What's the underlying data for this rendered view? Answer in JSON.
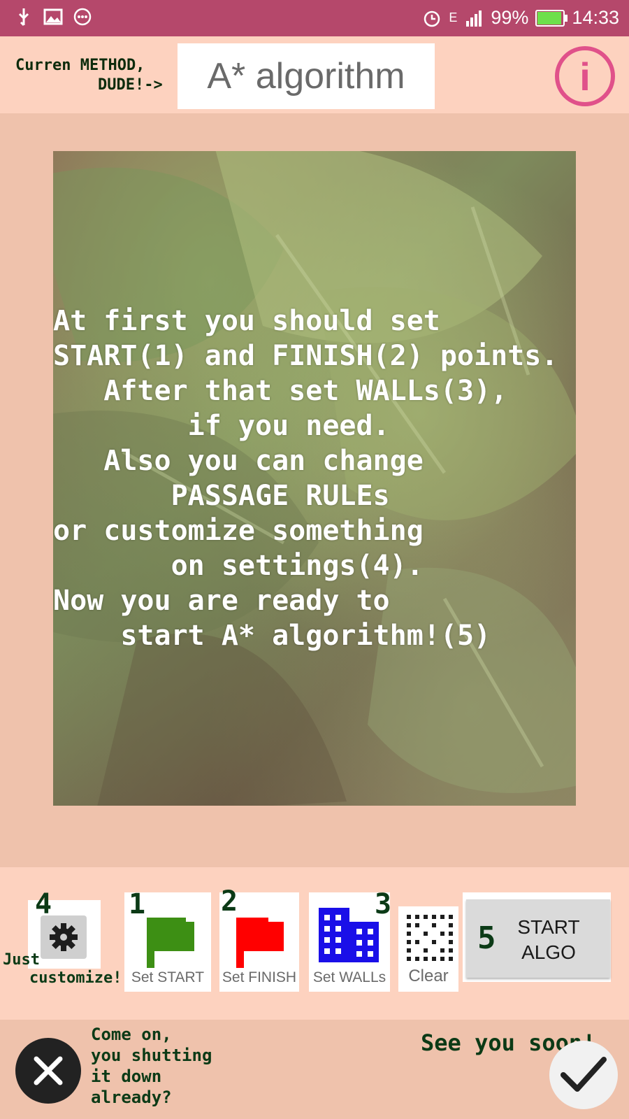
{
  "status_bar": {
    "icons_left": [
      "usb-icon",
      "image-icon",
      "more-icon"
    ],
    "network": "E",
    "battery": "99%",
    "battery_level": 0.99,
    "time": "14:33",
    "colors": {
      "bar": "#b5486b",
      "battery_fill": "#6ee04b"
    }
  },
  "header": {
    "method_label_line1": "Curren METHOD,",
    "method_label_line2": "DUDE!->",
    "current_method": "A* algorithm",
    "info_icon": "info-icon",
    "accent": "#e0518a"
  },
  "instructions": "At first you should set\nSTART(1) and FINISH(2) points.\n   After that set WALLs(3),\n        if you need.\n   Also you can change\n       PASSAGE RULEs\nor customize something\n       on settings(4).\nNow you are ready to\n    start A* algorithm!(5)",
  "toolbar": {
    "settings": {
      "number": "4",
      "icon": "gear-icon",
      "label_line1": "Just",
      "label_line2": "customize!"
    },
    "set_start": {
      "number": "1",
      "label": "Set START",
      "icon": "green-flag-icon",
      "color": "#3d8f14"
    },
    "set_finish": {
      "number": "2",
      "label": "Set FINISH",
      "icon": "red-flag-icon",
      "color": "#ff0000"
    },
    "set_walls": {
      "number": "3",
      "label": "Set WALLs",
      "icon": "building-icon",
      "color": "#1a0fe8"
    },
    "clear": {
      "label": "Clear",
      "icon": "dotted-grid-icon"
    },
    "start_algo": {
      "number": "5",
      "line1": "START",
      "line2": "ALGO"
    }
  },
  "footer": {
    "cancel_text": "Come on,\nyou shutting\nit down\nalready?",
    "confirm_text": "See you soon!",
    "cancel_icon": "close-icon",
    "confirm_icon": "checkmark-icon"
  }
}
